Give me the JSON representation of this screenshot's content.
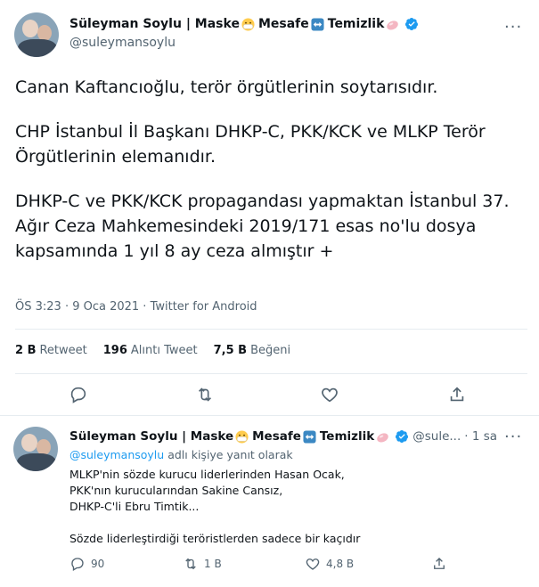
{
  "main_tweet": {
    "author": {
      "name": "Süleyman Soylu | Maske",
      "name_part2": "Mesafe",
      "name_part3": "Temizlik",
      "handle": "@suleymansoylu"
    },
    "paragraphs": [
      "Canan Kaftancıoğlu, terör örgütlerinin soytarısıdır.",
      "CHP İstanbul İl Başkanı DHKP-C, PKK/KCK ve MLKP Terör Örgütlerinin elemanıdır.",
      "DHKP-C ve PKK/KCK propagandası yapmaktan İstanbul 37. Ağır Ceza Mahkemesindeki 2019/171 esas no'lu dosya kapsamında 1 yıl 8 ay ceza almıştır +"
    ],
    "meta": "ÖS 3:23 · 9 Oca 2021 · Twitter for Android",
    "stats": {
      "retweets_count": "2 B",
      "retweets_label": "Retweet",
      "quotes_count": "196",
      "quotes_label": "Alıntı Tweet",
      "likes_count": "7,5 B",
      "likes_label": "Beğeni"
    }
  },
  "reply_tweet": {
    "author": {
      "name": "Süleyman Soylu | Maske",
      "name_part2": "Mesafe",
      "name_part3": "Temizlik",
      "handle_trunc": "@sule...",
      "time": "· 1 sa"
    },
    "replying_handle": "@suleymansoylu",
    "replying_suffix": "adlı kişiye yanıt olarak",
    "lines": [
      "MLKP'nin sözde kurucu liderlerinden Hasan Ocak,",
      "PKK'nın kurucularından Sakine Cansız,",
      "DHKP-C'li Ebru Timtik..."
    ],
    "last_line": "Sözde liderleştirdiği teröristlerden sadece bir kaçıdır",
    "actions": {
      "reply_count": "90",
      "retweet_count": "1 B",
      "like_count": "4,8 B"
    }
  },
  "colors": {
    "accent": "#1d9bf0",
    "text": "#0f1419",
    "secondary": "#536471",
    "divider": "#e6ecf0"
  },
  "icons": [
    "more-icon",
    "verified-icon",
    "mask-emoji-icon",
    "left-right-arrow-emoji-icon",
    "soap-emoji-icon",
    "reply-icon",
    "retweet-icon",
    "like-icon",
    "share-icon"
  ]
}
